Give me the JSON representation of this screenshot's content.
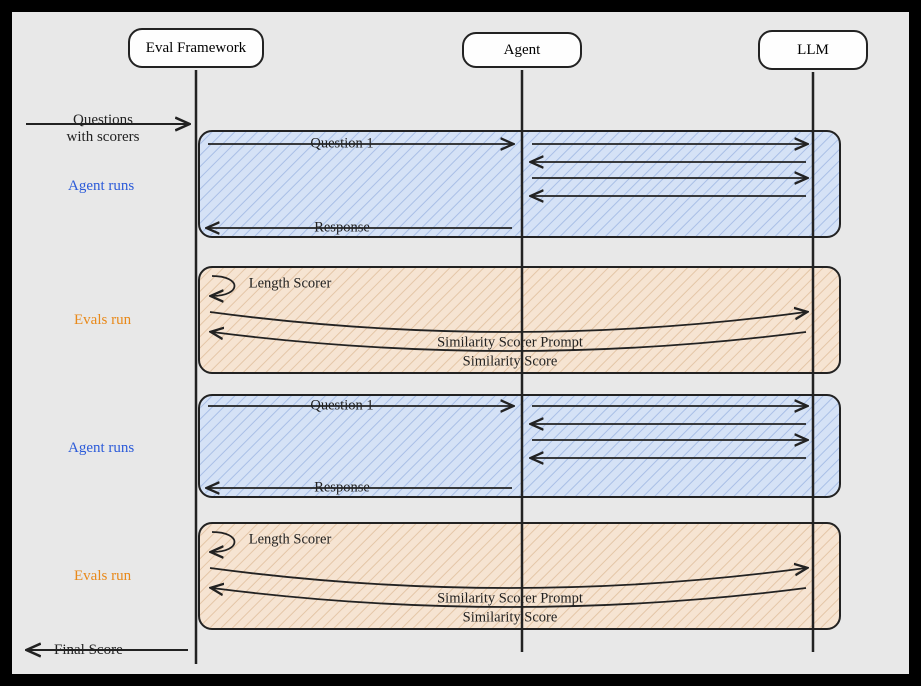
{
  "lanes": {
    "eval_framework": "Eval Framework",
    "agent": "Agent",
    "llm": "LLM"
  },
  "inputs": {
    "questions_with_scorers_line1": "Questions",
    "questions_with_scorers_line2": "with scorers",
    "final_score": "Final Score"
  },
  "phase_labels": {
    "agent_runs": "Agent runs",
    "evals_run": "Evals run"
  },
  "messages": {
    "question1": "Question 1",
    "response": "Response",
    "length_scorer": "Length Scorer",
    "similarity_scorer_prompt": "Similarity Scorer Prompt",
    "similarity_score": "Similarity Score"
  },
  "colors": {
    "agent_phase": "#d5e2f6",
    "evals_phase": "#f6e4d2",
    "agent_text": "#2c5bd9",
    "evals_text": "#e8891a",
    "stroke": "#222"
  }
}
